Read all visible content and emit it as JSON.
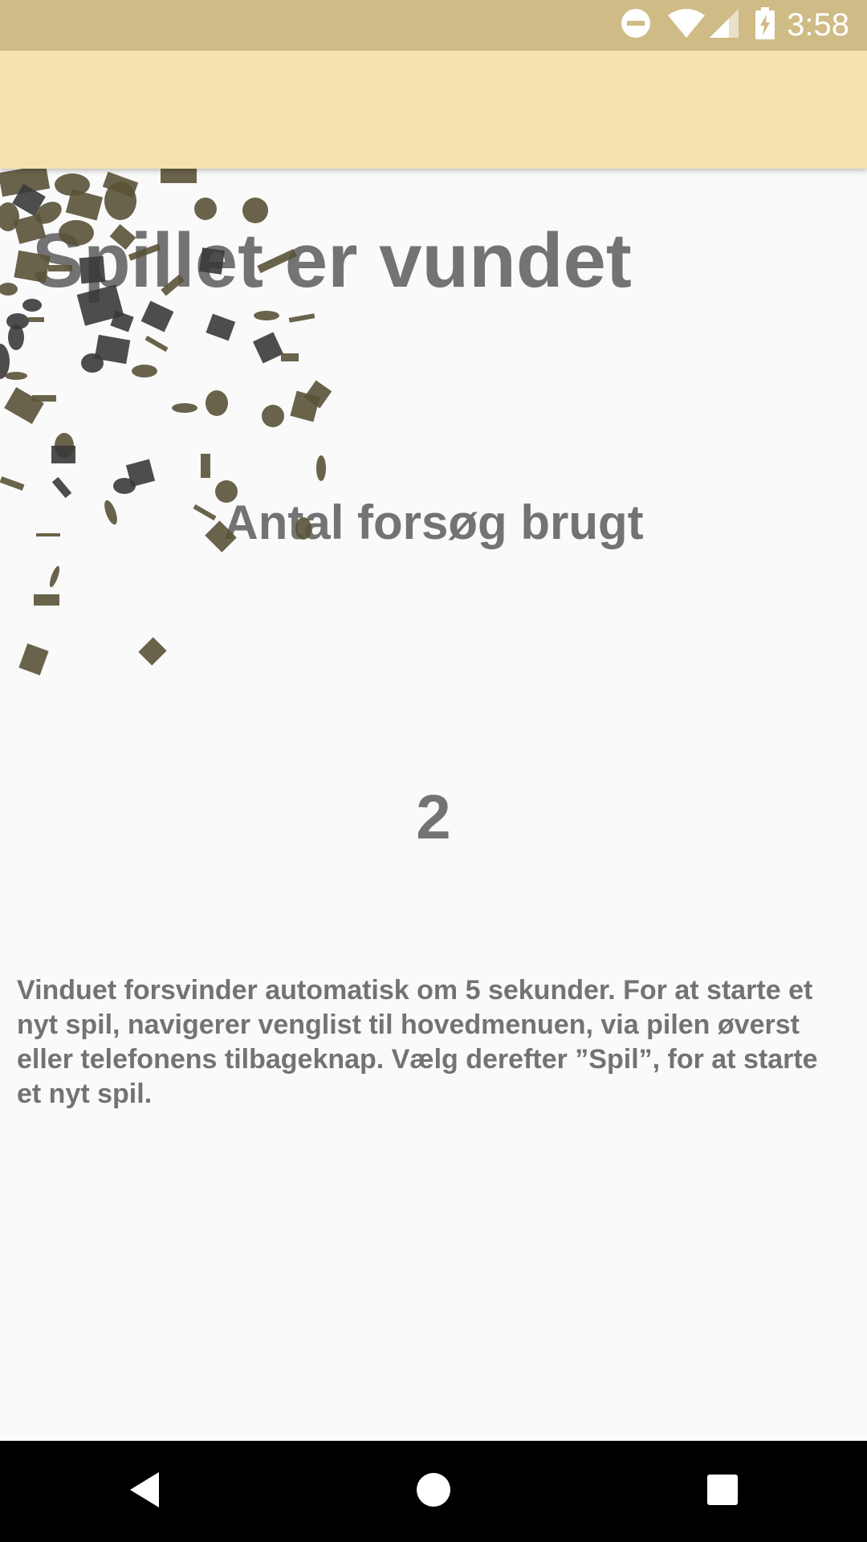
{
  "status_bar": {
    "time": "3:58",
    "icons": [
      "do-not-disturb-icon",
      "wifi-icon",
      "signal-icon",
      "battery-charging-icon"
    ]
  },
  "app_bar": {
    "title": ""
  },
  "main": {
    "title": "Spillet er vundet",
    "attempts_label": "Antal forsøg brugt",
    "attempts_value": "2",
    "info_text": "Vinduet forsvinder automatisk om 5 sekunder.  For at starte et nyt spil, navigerer venglist til hovedmenuen, via pilen øverst eller telefonens tilbageknap. Vælg derefter ”Spil”, for at starte et nyt spil."
  },
  "nav_bar": {
    "buttons": [
      "back-icon",
      "home-icon",
      "recents-icon"
    ]
  },
  "colors": {
    "status_bar": "#cfbb85",
    "app_bar": "#f5e3ad",
    "background": "#fafafa",
    "text": "#737373",
    "confetti_olive": "#5a5237",
    "confetti_dark": "#3a3a3a"
  }
}
